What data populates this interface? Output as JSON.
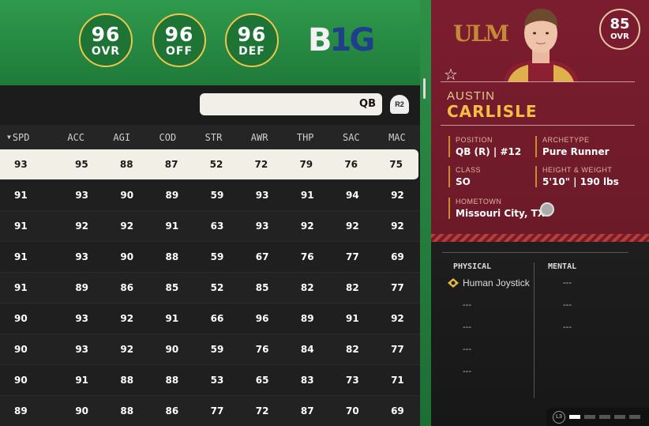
{
  "team_ratings": [
    {
      "value": "96",
      "label": "OVR"
    },
    {
      "value": "96",
      "label": "OFF"
    },
    {
      "value": "96",
      "label": "DEF"
    }
  ],
  "conference_logo": {
    "text_left": "B",
    "text_right": "1G"
  },
  "search": {
    "value": "QB",
    "button_label": "R2"
  },
  "table": {
    "headers": [
      "SPD",
      "ACC",
      "AGI",
      "COD",
      "STR",
      "AWR",
      "THP",
      "SAC",
      "MAC"
    ],
    "rows": [
      [
        "93",
        "95",
        "88",
        "87",
        "52",
        "72",
        "79",
        "76",
        "75"
      ],
      [
        "91",
        "93",
        "90",
        "89",
        "59",
        "93",
        "91",
        "94",
        "92"
      ],
      [
        "91",
        "92",
        "92",
        "91",
        "63",
        "93",
        "92",
        "92",
        "92"
      ],
      [
        "91",
        "93",
        "90",
        "88",
        "59",
        "67",
        "76",
        "77",
        "69"
      ],
      [
        "91",
        "89",
        "86",
        "85",
        "52",
        "85",
        "82",
        "82",
        "77"
      ],
      [
        "90",
        "93",
        "92",
        "91",
        "66",
        "96",
        "89",
        "91",
        "92"
      ],
      [
        "90",
        "93",
        "92",
        "90",
        "59",
        "76",
        "84",
        "82",
        "77"
      ],
      [
        "90",
        "91",
        "88",
        "88",
        "53",
        "65",
        "83",
        "73",
        "71"
      ],
      [
        "89",
        "90",
        "88",
        "86",
        "77",
        "72",
        "87",
        "70",
        "69"
      ]
    ]
  },
  "player": {
    "school_logo": "ULM",
    "ovr": "85",
    "ovr_label": "OVR",
    "first_name": "AUSTIN",
    "last_name": "CARLISLE",
    "position_label": "POSITION",
    "position": "QB (R) | #12",
    "archetype_label": "ARCHETYPE",
    "archetype": "Pure Runner",
    "class_label": "CLASS",
    "class": "SO",
    "hw_label": "HEIGHT & WEIGHT",
    "height_weight": "5'10\" | 190 lbs",
    "hometown_label": "HOMETOWN",
    "hometown": "Missouri City, TX"
  },
  "abilities": {
    "physical_label": "PHYSICAL",
    "mental_label": "MENTAL",
    "physical": [
      "Human Joystick",
      "---",
      "---",
      "---",
      "---"
    ],
    "mental": [
      "---",
      "---",
      "---"
    ]
  },
  "pager": {
    "button_label": "L3"
  },
  "colors": {
    "green": "#2f9a4d",
    "maroon": "#7c1d2f",
    "gold": "#f2be45"
  }
}
